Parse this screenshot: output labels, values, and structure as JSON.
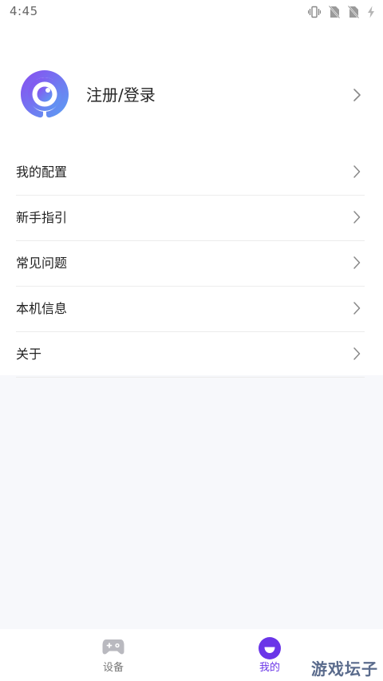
{
  "status_bar": {
    "time": "4:45",
    "icons": [
      "vibrate-icon",
      "sim-off-icon",
      "sim-off-icon",
      "charging-icon"
    ]
  },
  "profile": {
    "login_label": "注册/登录",
    "avatar_icon": "app-logo-icon"
  },
  "menu": {
    "items": [
      {
        "label": "我的配置"
      },
      {
        "label": "新手指引"
      },
      {
        "label": "常见问题"
      },
      {
        "label": "本机信息"
      },
      {
        "label": "关于"
      }
    ]
  },
  "tab_bar": {
    "tabs": [
      {
        "label": "设备",
        "icon": "gamepad-icon",
        "active": false
      },
      {
        "label": "我的",
        "icon": "smiley-icon",
        "active": true
      }
    ]
  },
  "watermark": "游戏坛子",
  "colors": {
    "accent": "#6a35e8",
    "logo_gradient_start": "#8a4cf0",
    "logo_gradient_end": "#5aa0f2",
    "background": "#f7f8fb",
    "panel": "#ffffff"
  }
}
